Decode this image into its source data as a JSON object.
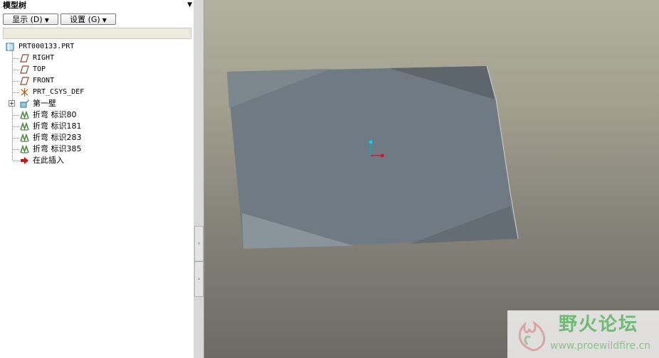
{
  "panel": {
    "title": "模型树",
    "menu_icon": "triangle-down-icon",
    "display_button": "显示 (D)",
    "settings_button": "设置 (G)"
  },
  "tree": {
    "root": "PRT000133.PRT",
    "items": [
      {
        "label": "RIGHT",
        "icon": "datum-plane-icon"
      },
      {
        "label": "TOP",
        "icon": "datum-plane-icon"
      },
      {
        "label": "FRONT",
        "icon": "datum-plane-icon"
      },
      {
        "label": "PRT_CSYS_DEF",
        "icon": "coordinate-system-icon"
      },
      {
        "label": "第一壁",
        "icon": "first-wall-icon"
      },
      {
        "label": "折弯 标识80",
        "icon": "bend-icon"
      },
      {
        "label": "折弯 标识181",
        "icon": "bend-icon"
      },
      {
        "label": "折弯 标识283",
        "icon": "bend-icon"
      },
      {
        "label": "折弯 标识385",
        "icon": "bend-icon"
      },
      {
        "label": "在此插入",
        "icon": "insert-here-arrow-icon"
      }
    ]
  },
  "colors": {
    "plate": "#707a82",
    "plate_light": "#8a949b",
    "plate_dark": "#5c646b",
    "bend_green": "#4a8a3a",
    "insert_red": "#d01010"
  },
  "watermark": {
    "title": "野火论坛",
    "url": "www.proewildfire.cn"
  }
}
